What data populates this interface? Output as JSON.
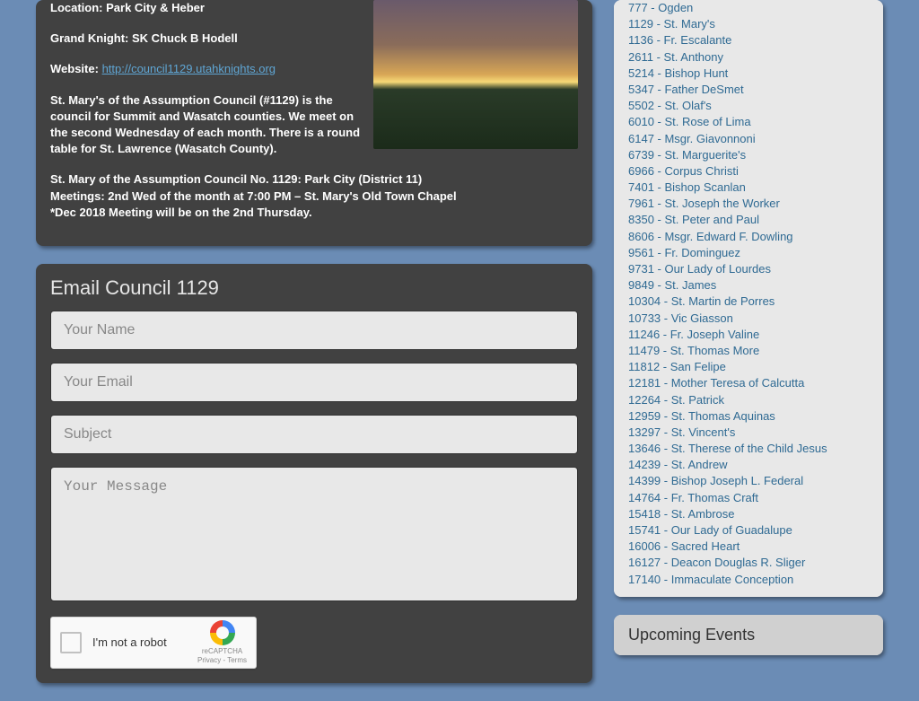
{
  "council": {
    "location_label": "Location:",
    "location_value": "Park City & Heber",
    "gk_label": "Grand Knight:",
    "gk_value": "SK Chuck B Hodell",
    "website_label": "Website:",
    "website_url": "http://council1129.utahknights.org",
    "desc_para1": "St. Mary's of the Assumption Council (#1129) is the council for Summit and Wasatch counties. We meet on the second Wednesday of each month. There is a round table for St. Lawrence (Wasatch County).",
    "meet_line1": "St. Mary of the Assumption Council No. 1129:  Park City (District 11)",
    "meet_line2": "Meetings: 2nd Wed of the month at 7:00 PM – St. Mary's Old Town Chapel",
    "meet_line3": "*Dec 2018 Meeting will be on the 2nd Thursday."
  },
  "form": {
    "heading": "Email Council 1129",
    "name_ph": "Your Name",
    "email_ph": "Your Email",
    "subject_ph": "Subject",
    "message_ph": "Your Message",
    "captcha_label": "I'm not a robot",
    "captcha_brand": "reCAPTCHA",
    "captcha_terms": "Privacy - Terms"
  },
  "sidebar": {
    "councils": [
      "777 - Ogden",
      "1129 - St. Mary's",
      "1136 - Fr. Escalante",
      "2611 - St. Anthony",
      "5214 - Bishop Hunt",
      "5347 - Father DeSmet",
      "5502 - St. Olaf's",
      "6010 - St. Rose of Lima",
      "6147 - Msgr. Giavonnoni",
      "6739 - St. Marguerite's",
      "6966 - Corpus Christi",
      "7401 - Bishop Scanlan",
      "7961 - St. Joseph the Worker",
      "8350 - St. Peter and Paul",
      "8606 - Msgr. Edward F. Dowling",
      "9561 - Fr. Dominguez",
      "9731 - Our Lady of Lourdes",
      "9849 - St. James",
      "10304 - St. Martin de Porres",
      "10733 - Vic Giasson",
      "11246 - Fr. Joseph Valine",
      "11479 - St. Thomas More",
      "11812 - San Felipe",
      "12181 - Mother Teresa of Calcutta",
      "12264 - St. Patrick",
      "12959 - St. Thomas Aquinas",
      "13297 - St. Vincent's",
      "13646 - St. Therese of the Child Jesus",
      "14239 - St. Andrew",
      "14399 - Bishop Joseph L. Federal",
      "14764 - Fr. Thomas Craft",
      "15418 - St. Ambrose",
      "15741 - Our Lady of Guadalupe",
      "16006 - Sacred Heart",
      "16127 - Deacon Douglas R. Sliger",
      "17140 - Immaculate Conception"
    ],
    "upcoming_heading": "Upcoming Events"
  }
}
